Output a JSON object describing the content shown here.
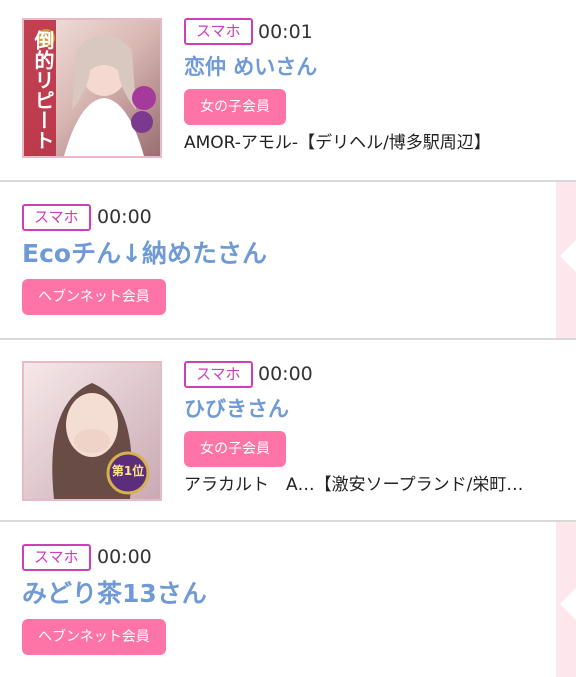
{
  "entries": [
    {
      "badge": "スマホ",
      "time": "00:01",
      "name": "恋仲 めいさん",
      "member": "女の子会員",
      "shop": "AMOR-アモル-【デリヘル/博多駅周辺】",
      "thumb_text": "倒的リピート"
    },
    {
      "badge": "スマホ",
      "time": "00:00",
      "name": "Ecoチん↓納めたさん",
      "member": "ヘブンネット会員"
    },
    {
      "badge": "スマホ",
      "time": "00:00",
      "name": "ひびきさん",
      "member": "女の子会員",
      "shop": "アラカルト　A…【激安ソープランド/栄町…",
      "thumb_text": "第1位"
    },
    {
      "badge": "スマホ",
      "time": "00:00",
      "name": "みどり茶13さん",
      "member": "ヘブンネット会員"
    }
  ],
  "colors": {
    "badge": "#cc3fba",
    "name": "#6f9ad6",
    "member_button": "#ff74a6",
    "side_strip": "#fde6ec",
    "divider": "#d9d9d9"
  }
}
